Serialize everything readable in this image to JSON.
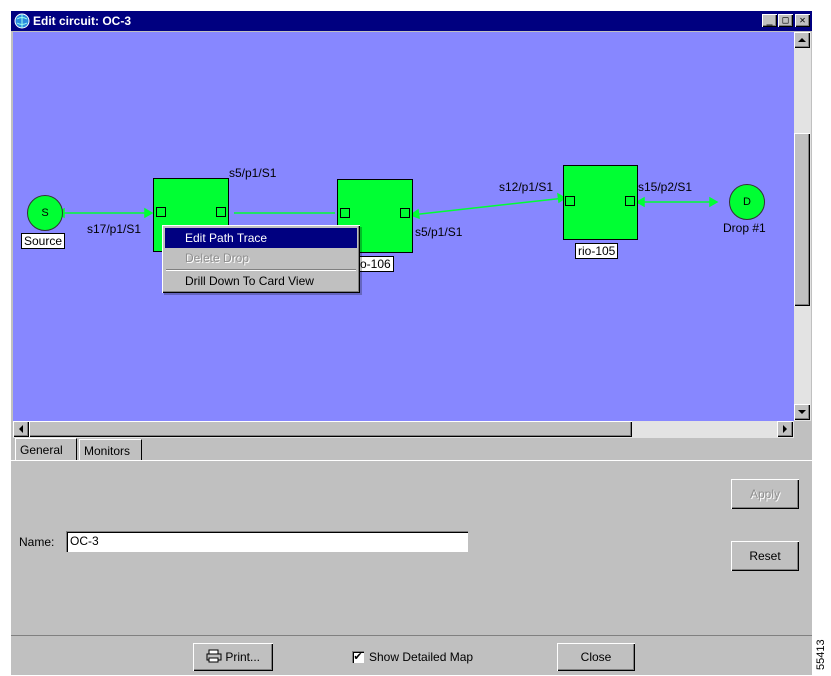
{
  "window": {
    "title": "Edit circuit: OC-3",
    "controls": {
      "minimize": "_",
      "maximize": "□",
      "close": "✕"
    }
  },
  "map": {
    "source_label": "S",
    "source_name": "Source",
    "drop_label": "D",
    "drop_name": "Drop #1",
    "links": {
      "l1": "s17/p1/S1",
      "l2": "s5/p1/S1",
      "l3": "s5/p1/S1",
      "l4": "s12/p1/S1",
      "l5": "s15/p2/S1"
    },
    "nodes": {
      "n2": "o-106",
      "n3": "rio-105"
    }
  },
  "context_menu": {
    "items": [
      {
        "label": "Edit Path Trace",
        "state": "selected"
      },
      {
        "label": "Delete Drop",
        "state": "disabled"
      },
      {
        "label": "Drill Down To Card View",
        "state": "normal"
      }
    ]
  },
  "tabs": [
    {
      "label": "General",
      "active": true
    },
    {
      "label": "Monitors",
      "active": false
    }
  ],
  "general": {
    "name_label": "Name:",
    "name_value": "OC-3",
    "apply": "Apply",
    "reset": "Reset"
  },
  "footer": {
    "print": "Print...",
    "show_detailed_map": "Show Detailed Map",
    "show_detailed_map_checked": true,
    "close": "Close"
  },
  "side_number": "55413",
  "colors": {
    "canvas": "#8787ff",
    "node": "#00ff33",
    "link": "#00ff33",
    "titlebar": "#000080"
  }
}
